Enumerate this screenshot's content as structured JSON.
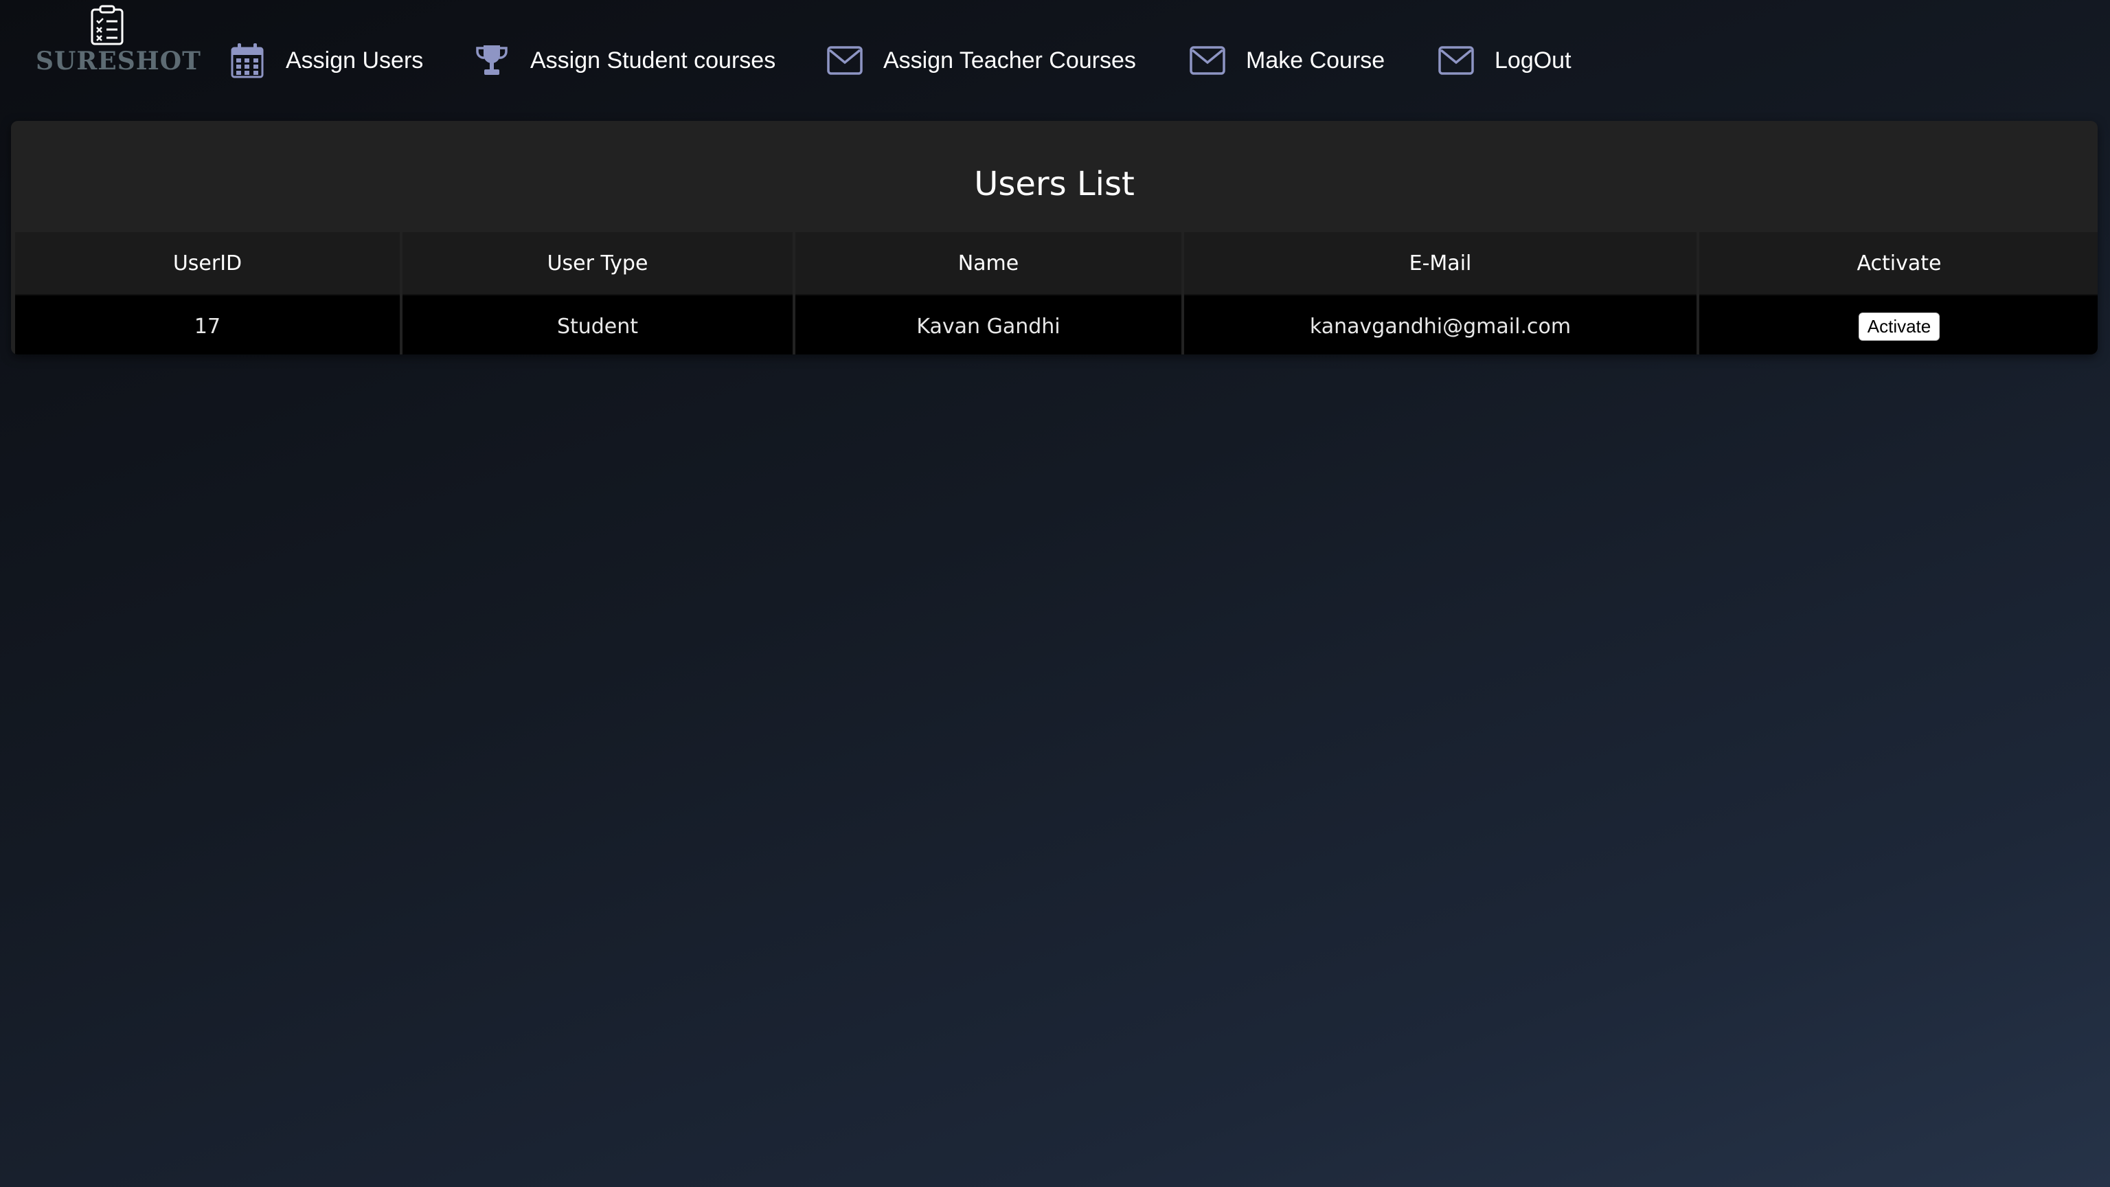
{
  "brand": {
    "logo_text": "SURESHOT"
  },
  "nav": {
    "items": [
      {
        "label": "Assign Users",
        "icon": "calendar-icon"
      },
      {
        "label": "Assign Student courses",
        "icon": "trophy-icon"
      },
      {
        "label": "Assign Teacher Courses",
        "icon": "envelope-icon"
      },
      {
        "label": "Make Course",
        "icon": "envelope-icon"
      },
      {
        "label": "LogOut",
        "icon": "envelope-icon"
      }
    ]
  },
  "users_list": {
    "title": "Users List",
    "columns": [
      "UserID",
      "User Type",
      "Name",
      "E-Mail",
      "Activate"
    ],
    "rows": [
      {
        "user_id": "17",
        "user_type": "Student",
        "name": "Kavan Gandhi",
        "email": "kanavgandhi@gmail.com",
        "action_label": "Activate"
      }
    ]
  },
  "colors": {
    "icon": "#8e95c4",
    "panel": "#222222",
    "header_cell": "#1b1b1b",
    "row_cell": "#000000"
  }
}
